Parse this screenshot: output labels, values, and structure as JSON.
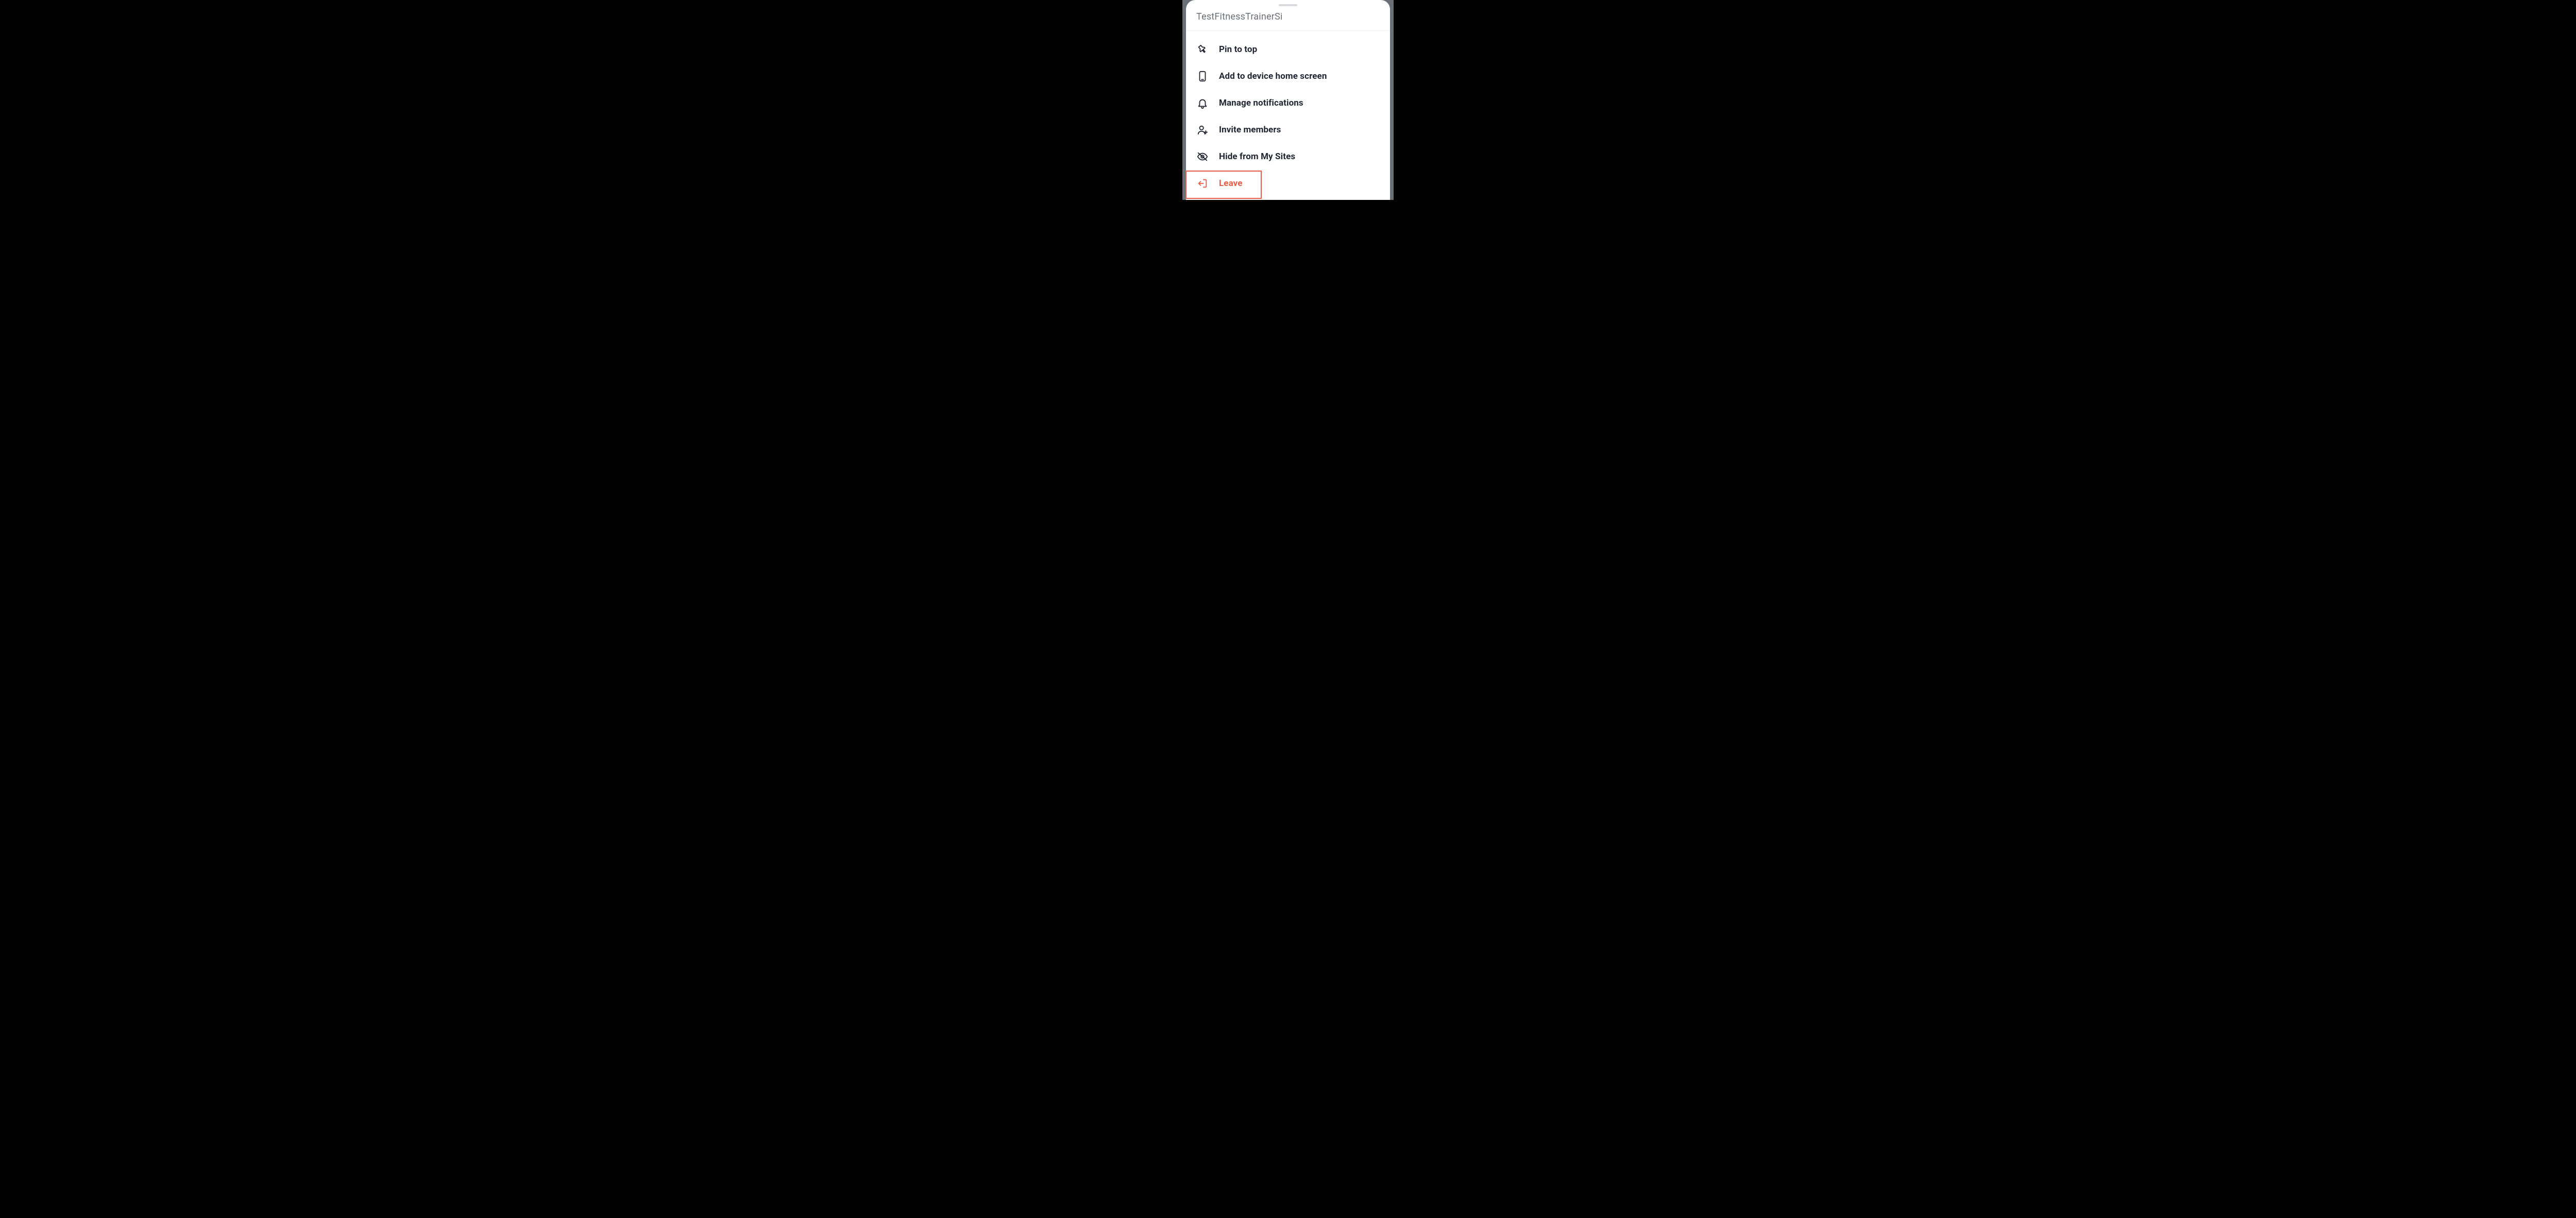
{
  "sheet": {
    "title": "TestFitnessTrainerSi"
  },
  "menu": {
    "items": [
      {
        "label": "Pin to top"
      },
      {
        "label": "Add to device home screen"
      },
      {
        "label": "Manage notifications"
      },
      {
        "label": "Invite members"
      },
      {
        "label": "Hide from My Sites"
      },
      {
        "label": "Leave"
      }
    ]
  }
}
